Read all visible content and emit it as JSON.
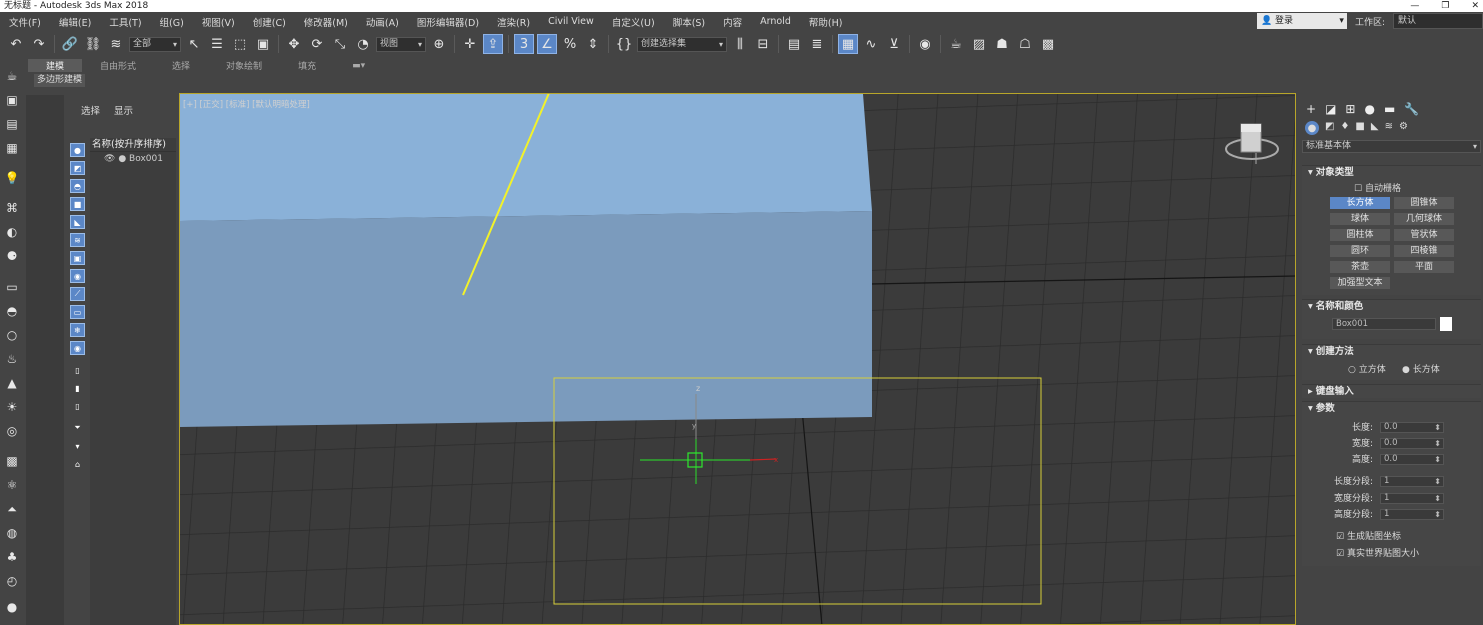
{
  "window": {
    "title": "无标题 - Autodesk 3ds Max 2018",
    "controls": [
      "—",
      "❐",
      "✕"
    ]
  },
  "menu": [
    "文件(F)",
    "编辑(E)",
    "工具(T)",
    "组(G)",
    "视图(V)",
    "创建(C)",
    "修改器(M)",
    "动画(A)",
    "图形编辑器(D)",
    "渲染(R)",
    "Civil View",
    "自定义(U)",
    "脚本(S)",
    "内容",
    "Arnold",
    "帮助(H)"
  ],
  "account": {
    "login": "登录",
    "workspace_label": "工作区:",
    "workspace_value": "默认"
  },
  "toolbar": {
    "selection_filter": "全部",
    "ref_coord": "视图",
    "named_selection": "创建选择集",
    "active_tools": [
      "angle-snap-toggle",
      "percent-snap-toggle"
    ]
  },
  "ribbon": {
    "tabs": [
      "建模",
      "自由形式",
      "选择",
      "对象绘制",
      "填充"
    ],
    "active_tab": "建模",
    "sub_label": "多边形建模"
  },
  "scene_explorer": {
    "tabs": [
      "选择",
      "显示"
    ],
    "column_header": "名称(按升序排序)",
    "rows": [
      "Box001"
    ]
  },
  "viewport": {
    "label": "[+] [正交] [标准] [默认明暗处理]",
    "axis_z": "z",
    "axis_y": "y",
    "axis_x": "x",
    "border_color": "#b8a62a",
    "box_color": "#8bb0d6",
    "arrow_color": "#f2f22a"
  },
  "command_panel": {
    "category": "标准基本体",
    "rollouts": {
      "object_type": {
        "title": "对象类型",
        "autogrid": "自动栅格",
        "buttons": [
          "长方体",
          "圆锥体",
          "球体",
          "几何球体",
          "圆柱体",
          "管状体",
          "圆环",
          "四棱锥",
          "茶壶",
          "平面",
          "加强型文本"
        ],
        "selected": "长方体"
      },
      "name_color": {
        "title": "名称和颜色",
        "name": "Box001"
      },
      "creation_method": {
        "title": "创建方法",
        "options": [
          "立方体",
          "长方体"
        ],
        "selected": "长方体"
      },
      "keyboard_entry": {
        "title": "键盘输入"
      },
      "parameters": {
        "title": "参数",
        "fields": [
          {
            "label": "长度:",
            "value": "0.0"
          },
          {
            "label": "宽度:",
            "value": "0.0"
          },
          {
            "label": "高度:",
            "value": "0.0"
          },
          {
            "label": "长度分段:",
            "value": "1"
          },
          {
            "label": "宽度分段:",
            "value": "1"
          },
          {
            "label": "高度分段:",
            "value": "1"
          }
        ],
        "checks": [
          "生成贴图坐标",
          "真实世界贴图大小"
        ]
      }
    }
  }
}
